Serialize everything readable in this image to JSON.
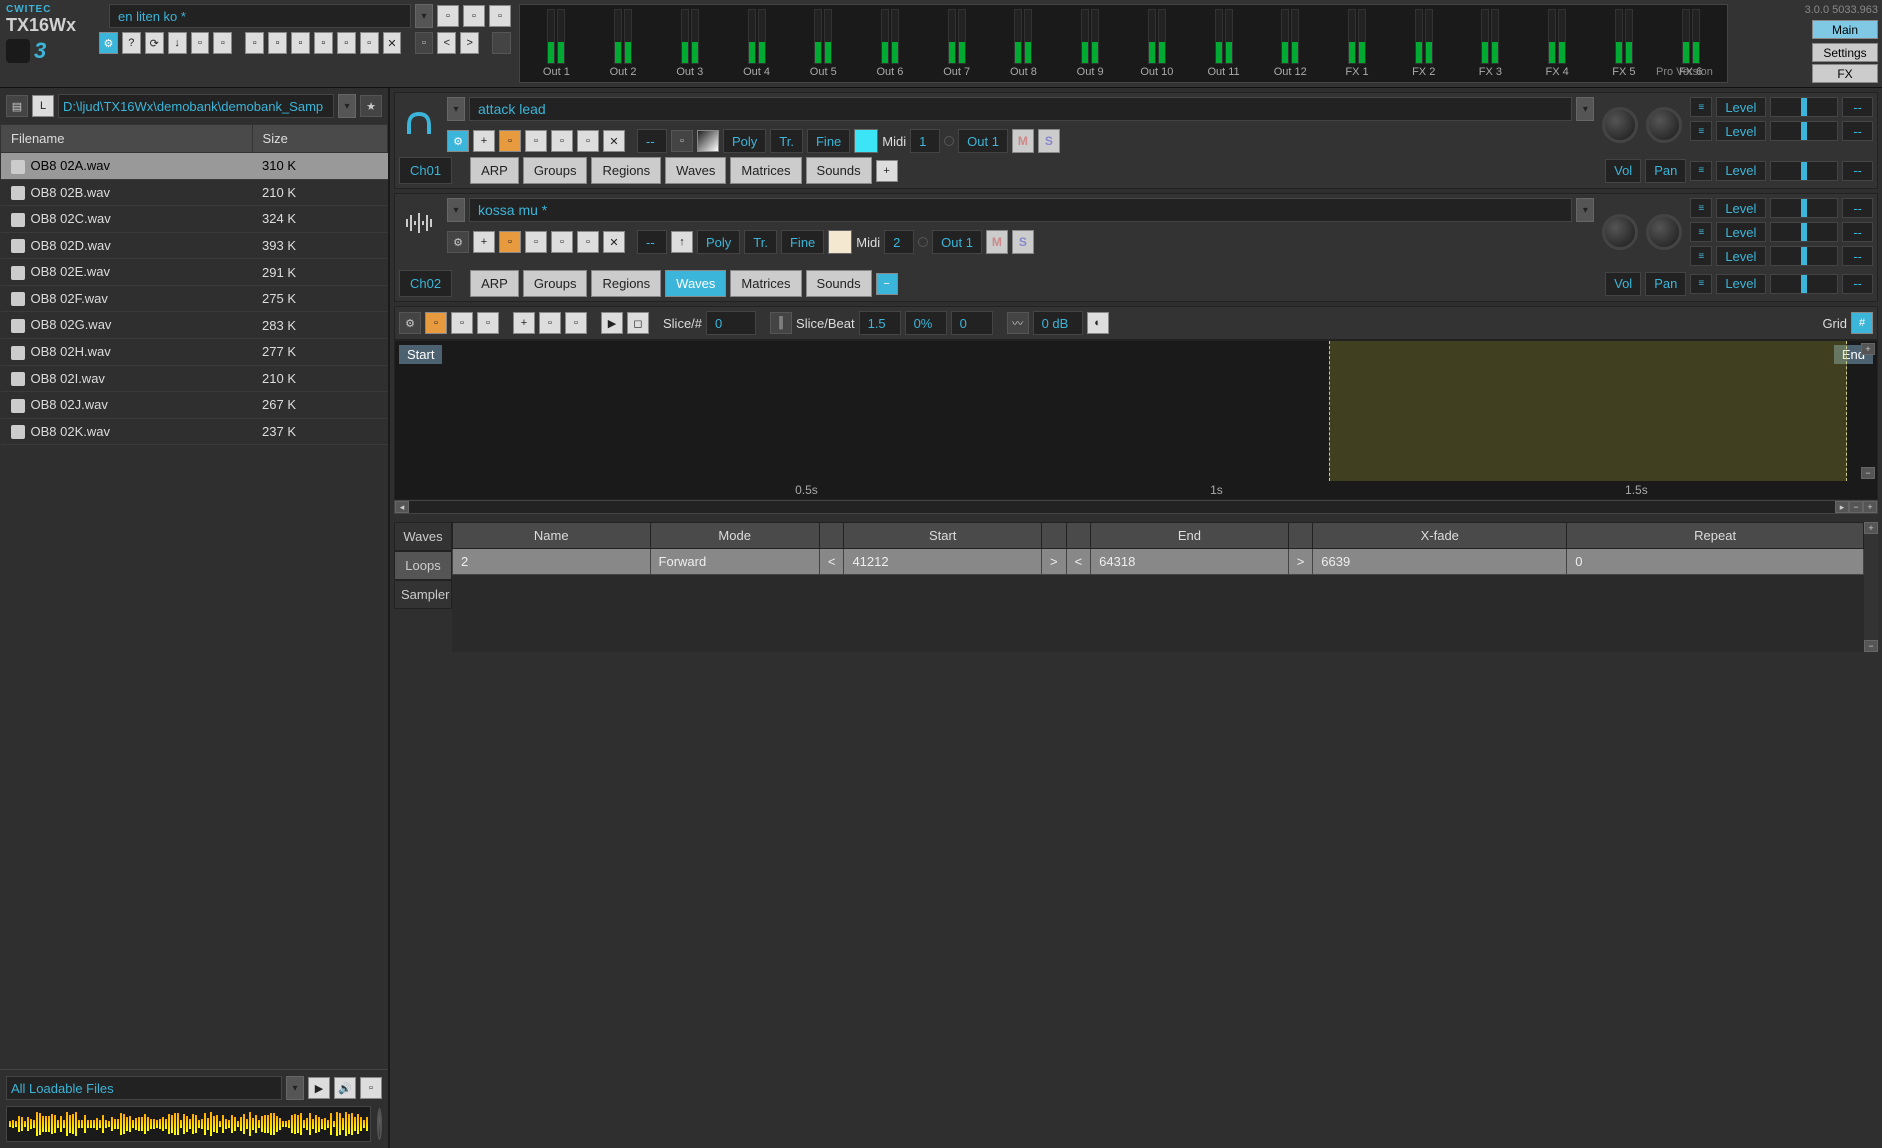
{
  "app": {
    "brand": "CWITEC",
    "name": "TX16Wx",
    "model": "3"
  },
  "header": {
    "performance_name": "en liten ko *",
    "version": "3.0.0 5033.963",
    "edition": "Pro Version",
    "nav": {
      "main": "Main",
      "settings": "Settings",
      "fx": "FX"
    }
  },
  "outputs": [
    "Out 1",
    "Out 2",
    "Out 3",
    "Out 4",
    "Out 5",
    "Out 6",
    "Out 7",
    "Out 8",
    "Out 9",
    "Out 10",
    "Out 11",
    "Out 12",
    "FX 1",
    "FX 2",
    "FX 3",
    "FX 4",
    "FX 5",
    "FX 6"
  ],
  "browser": {
    "path": "D:\\ljud\\TX16Wx\\demobank\\demobank_Samp",
    "columns": {
      "filename": "Filename",
      "size": "Size"
    },
    "files": [
      {
        "name": "OB8 02A.wav",
        "size": "310 K",
        "selected": true
      },
      {
        "name": "OB8 02B.wav",
        "size": "210 K"
      },
      {
        "name": "OB8 02C.wav",
        "size": "324 K"
      },
      {
        "name": "OB8 02D.wav",
        "size": "393 K"
      },
      {
        "name": "OB8 02E.wav",
        "size": "291 K"
      },
      {
        "name": "OB8 02F.wav",
        "size": "275 K"
      },
      {
        "name": "OB8 02G.wav",
        "size": "283 K"
      },
      {
        "name": "OB8 02H.wav",
        "size": "277 K"
      },
      {
        "name": "OB8 02I.wav",
        "size": "210 K"
      },
      {
        "name": "OB8 02J.wav",
        "size": "267 K"
      },
      {
        "name": "OB8 02K.wav",
        "size": "237 K"
      }
    ],
    "filter": "All Loadable Files"
  },
  "channels": [
    {
      "id": "Ch01",
      "name": "attack lead",
      "poly": "Poly",
      "tr": "Tr.",
      "fine": "Fine",
      "midi_lbl": "Midi",
      "midi": "1",
      "out": "Out 1",
      "vol": "Vol",
      "pan": "Pan",
      "level": "Level",
      "dash": "--",
      "tabs": {
        "arp": "ARP",
        "groups": "Groups",
        "regions": "Regions",
        "waves": "Waves",
        "matrices": "Matrices",
        "sounds": "Sounds"
      },
      "active_tab": ""
    },
    {
      "id": "Ch02",
      "name": "kossa mu *",
      "poly": "Poly",
      "tr": "Tr.",
      "fine": "Fine",
      "midi_lbl": "Midi",
      "midi": "2",
      "out": "Out 1",
      "vol": "Vol",
      "pan": "Pan",
      "level": "Level",
      "dash": "--",
      "tabs": {
        "arp": "ARP",
        "groups": "Groups",
        "regions": "Regions",
        "waves": "Waves",
        "matrices": "Matrices",
        "sounds": "Sounds"
      },
      "active_tab": "Waves"
    }
  ],
  "wave_editor": {
    "slice_num_lbl": "Slice/#",
    "slice_num": "0",
    "slice_beat_lbl": "Slice/Beat",
    "slice_beat": "1.5",
    "pct": "0%",
    "offset": "0",
    "gain": "0 dB",
    "grid_lbl": "Grid",
    "start_lbl": "Start",
    "end_lbl": "End",
    "time_05": "0.5s",
    "time_1": "1s",
    "time_15": "1.5s"
  },
  "loop_table": {
    "side_tabs": {
      "waves": "Waves",
      "loops": "Loops",
      "sampler": "Sampler"
    },
    "columns": {
      "name": "Name",
      "mode": "Mode",
      "start": "Start",
      "end": "End",
      "xfade": "X-fade",
      "repeat": "Repeat"
    },
    "rows": [
      {
        "name": "2",
        "mode": "Forward",
        "start": "41212",
        "end": "64318",
        "xfade": "6639",
        "repeat": "0"
      }
    ]
  },
  "icons": {
    "gear": "⚙",
    "help": "?",
    "loop": "⟳",
    "down": "↓",
    "folder": "📁",
    "trash": "🗑",
    "plus": "+",
    "minus": "−",
    "x": "✕",
    "prev": "<",
    "next": ">",
    "play": "▶",
    "speaker": "🔊",
    "star": "★",
    "grid": "#",
    "sliders": "≡",
    "arrowup": "↑"
  }
}
